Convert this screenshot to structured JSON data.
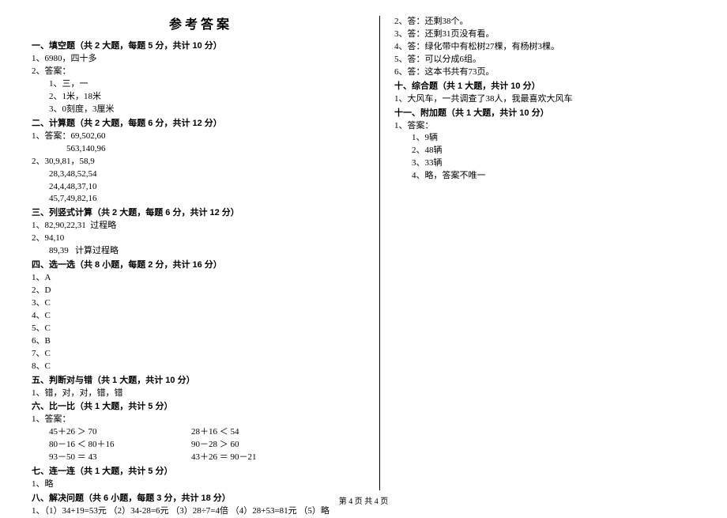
{
  "title": "参考答案",
  "footer": "第 4 页  共 4 页",
  "left": {
    "s1": {
      "head": "一、填空题（共 2 大题，每题 5 分，共计 10 分）",
      "l1": "1、6980，四十多",
      "l2": "2、答案：",
      "l3": "1、三，一",
      "l4": "2、1米，18米",
      "l5": "3、0刻度，3厘米"
    },
    "s2": {
      "head": "二、计算题（共 2 大题，每题 6 分，共计 12 分）",
      "l1": "1、答案：69,502,60",
      "l2": "563,140,96",
      "l3": "2、30,9,81，58,9",
      "l4": "28,3,48,52,54",
      "l5": "24,4,48,37,10",
      "l6": "45,7,49,82,16"
    },
    "s3": {
      "head": "三、列竖式计算（共 2 大题，每题 6 分，共计 12 分）",
      "l1": "1、82,90,22,31  过程略",
      "l2": "2、94,10",
      "l3": "89,39   计算过程略"
    },
    "s4": {
      "head": "四、选一选（共 8 小题，每题 2 分，共计 16 分）",
      "i1": "1、A",
      "i2": "2、D",
      "i3": "3、C",
      "i4": "4、C",
      "i5": "5、C",
      "i6": "6、B",
      "i7": "7、C",
      "i8": "8、C"
    },
    "s5": {
      "head": "五、判断对与错（共 1 大题，共计 10 分）",
      "l1": "1、错，对，对，错，错"
    },
    "s6": {
      "head": "六、比一比（共 1 大题，共计 5 分）",
      "l1": "1、答案：",
      "r1a": "45＋26 ＞ 70",
      "r1b": "28＋16 ＜ 54",
      "r2a": "80－16 ＜ 80＋16",
      "r2b": "90－28 ＞ 60",
      "r3a": "93－50 ＝ 43",
      "r3b": "43＋26 ＝ 90－21"
    },
    "s7": {
      "head": "七、连一连（共 1 大题，共计 5 分）",
      "l1": "1、略"
    },
    "s8": {
      "head": "八、解决问题（共 6 小题，每题 3 分，共计 18 分）",
      "l1": "1、（1）34+19=53元 （2）34-28=6元 （3）28÷7=4倍 （4）28+53=81元 （5）略"
    }
  },
  "right": {
    "pre": {
      "l1": "2、答：还剩38个。",
      "l2": "3、答：还剩31页没有看。",
      "l3": "4、答：绿化带中有松树27棵，有杨树3棵。",
      "l4": "5、答：可以分成6组。",
      "l5": "6、答：这本书共有73页。"
    },
    "s10": {
      "head": "十、综合题（共 1 大题，共计 10 分）",
      "l1": "1、大风车，一共调查了38人，我最喜欢大风车"
    },
    "s11": {
      "head": "十一、附加题（共 1 大题，共计 10 分）",
      "l1": "1、答案：",
      "i1": "1、9辆",
      "i2": "2、48辆",
      "i3": "3、33辆",
      "i4": "4、略，答案不唯一"
    }
  }
}
